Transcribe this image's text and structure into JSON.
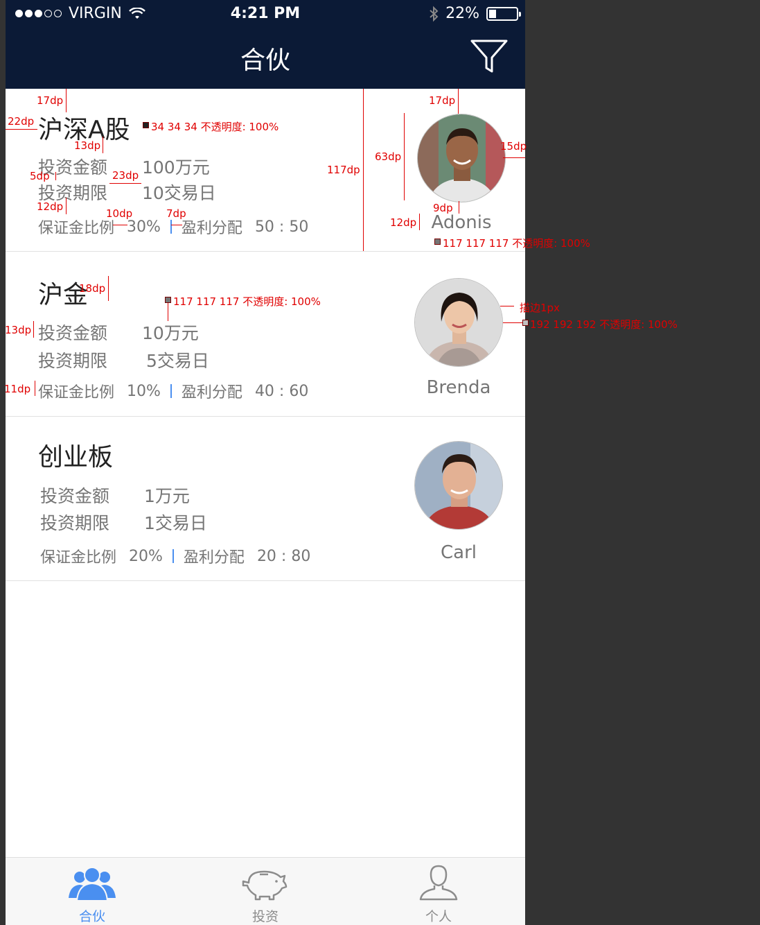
{
  "status_bar": {
    "carrier": "VIRGIN",
    "time": "4:21 PM",
    "battery": "22%"
  },
  "nav": {
    "title": "合伙",
    "filter_icon": "filter-icon"
  },
  "cards": [
    {
      "title": "沪深A股",
      "amount_label": "投资金额",
      "amount_value": "100万元",
      "period_label": "投资期限",
      "period_value": "10交易日",
      "margin_label": "保证金比例",
      "margin_value": "30%",
      "split_label": "盈利分配",
      "split_value": "50 : 50",
      "name": "Adonis"
    },
    {
      "title": "沪金",
      "amount_label": "投资金额",
      "amount_value": "10万元",
      "period_label": "投资期限",
      "period_value": "5交易日",
      "margin_label": "保证金比例",
      "margin_value": "10%",
      "split_label": "盈利分配",
      "split_value": "40 : 60",
      "name": "Brenda"
    },
    {
      "title": "创业板",
      "amount_label": "投资金额",
      "amount_value": "1万元",
      "period_label": "投资期限",
      "period_value": "1交易日",
      "margin_label": "保证金比例",
      "margin_value": "20%",
      "split_label": "盈利分配",
      "split_value": "20 : 80",
      "name": "Carl"
    }
  ],
  "tabs": [
    {
      "label": "合伙",
      "icon": "group-icon",
      "active": true
    },
    {
      "label": "投资",
      "icon": "piggy-bank-icon",
      "active": false
    },
    {
      "label": "个人",
      "icon": "person-icon",
      "active": false
    }
  ],
  "annotations": {
    "a17dp_left": "17dp",
    "a22dp": "22dp",
    "a13dp": "13dp",
    "a5dp": "5dp",
    "a23dp": "23dp",
    "a12dp": "12dp",
    "a10dp": "10dp",
    "a7dp": "7dp",
    "title_color": "34 34 34 不透明度: 100%",
    "a117dp": "117dp",
    "a17dp_right": "17dp",
    "a63dp": "63dp",
    "a15dp": "15dp",
    "a9dp": "9dp",
    "a12dp_right": "12dp",
    "name_color": "117 117 117 不透明度: 100%",
    "a18dp": "18dp",
    "text_color": "117 117 117 不透明度: 100%",
    "a13dp_b": "13dp",
    "a11dp": "11dp",
    "stroke": "描边1px",
    "stroke_color": "192 192 192 不透明度: 100%"
  },
  "colors": {
    "nav_bg": "#0b1a36",
    "accent": "#4a8ff0",
    "title_text": "#222222",
    "body_text": "#757575",
    "avatar_stroke": "#c0c0c0",
    "annotation": "#e00000"
  }
}
